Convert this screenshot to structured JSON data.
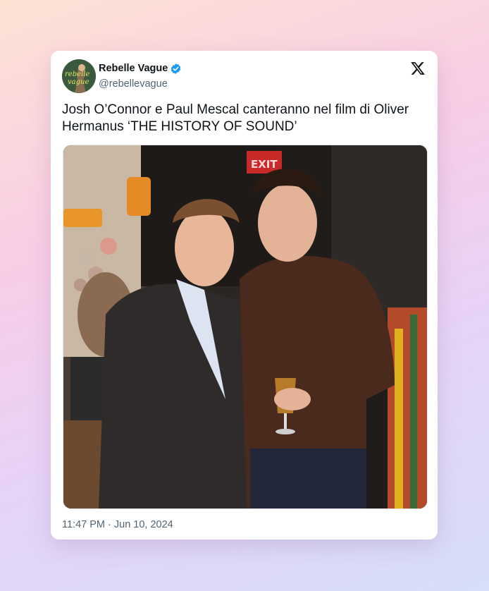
{
  "tweet": {
    "author_name": "Rebelle Vague",
    "author_handle": "@rebellevague",
    "avatar_text": "rebelle vague",
    "text": "Josh O’Connor e Paul Mescal canteranno nel film di Oliver Hermanus ‘THE HISTORY OF SOUND’",
    "timestamp": "11:47 PM · Jun 10, 2024",
    "photo_sign": "EXIT"
  },
  "icons": {
    "verified": "verified-badge-icon",
    "platform": "x-logo-icon"
  },
  "colors": {
    "verified_blue": "#1d9bf0",
    "text_primary": "#0f1419",
    "text_secondary": "#536471"
  }
}
